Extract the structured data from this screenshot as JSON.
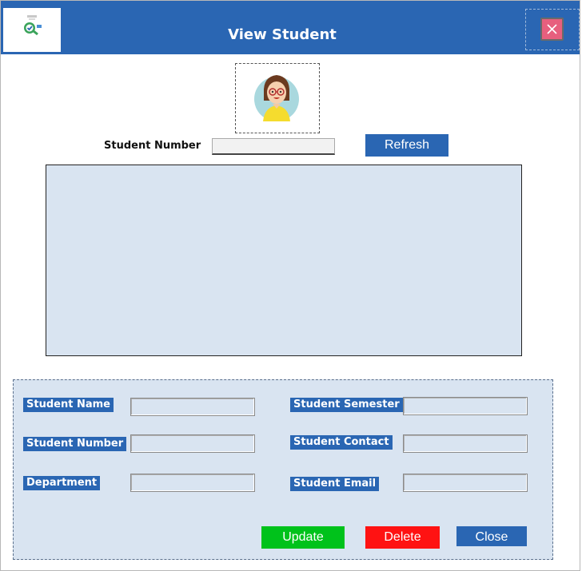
{
  "window": {
    "title": "View Student"
  },
  "icons": {
    "logo": "search-check-icon",
    "close": "close-icon",
    "avatar": "student-avatar"
  },
  "search": {
    "label": "Student Number",
    "value": "",
    "refresh_label": "Refresh"
  },
  "form": {
    "fields": [
      {
        "label": "Student Name",
        "value": ""
      },
      {
        "label": "Student Number",
        "value": ""
      },
      {
        "label": "Department",
        "value": ""
      },
      {
        "label": "Student Semester",
        "value": ""
      },
      {
        "label": "Student Contact",
        "value": ""
      },
      {
        "label": "Student Email",
        "value": ""
      }
    ]
  },
  "actions": {
    "update_label": "Update",
    "delete_label": "Delete",
    "close_label": "Close"
  },
  "colors": {
    "header": "#2a66b3",
    "panel": "#d9e4f1",
    "update": "#00c21b",
    "delete": "#ff1212",
    "close_x": "#e75f7e"
  }
}
